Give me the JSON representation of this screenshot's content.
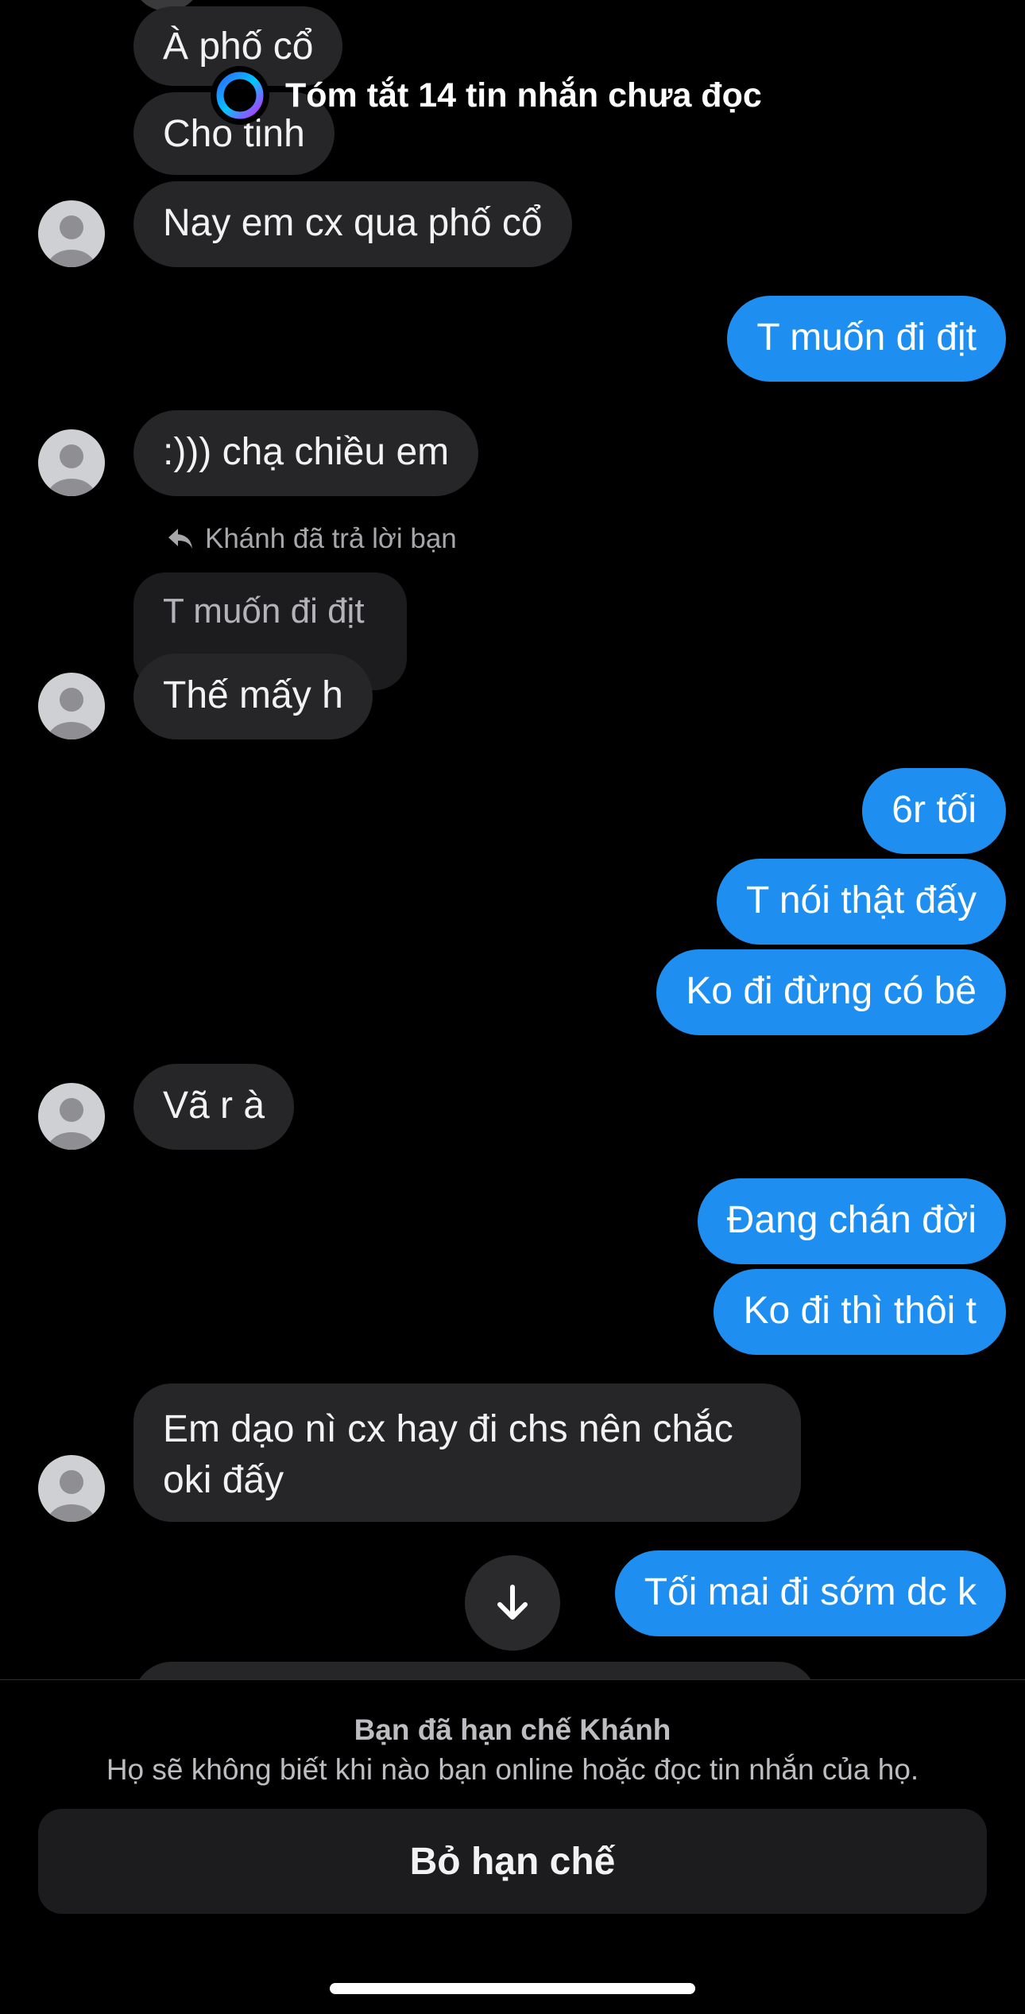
{
  "summary": {
    "text": "Tóm tắt 14 tin nhắn chưa đọc"
  },
  "messages": {
    "m0": "À phố cổ",
    "m1": "Cho tinh",
    "m2": "Nay em cx qua phố cổ",
    "m3": "T muốn đi địt",
    "m4": ":))) chạ chiều em",
    "reply_label": "Khánh đã trả lời bạn",
    "quoted": "T muốn đi địt",
    "m5": "Thế mấy h",
    "m6": "6r tối",
    "m7": "T nói thật đấy",
    "m8": "Ko đi đừng có bê",
    "m9": "Vã r à",
    "m10": "Đang chán đời",
    "m11": "Ko đi thì thôi t",
    "m12": "Em dạo nì cx hay đi chs nên chắc oki đấy",
    "m13": "Tối mai đi sớm dc k"
  },
  "footer": {
    "title": "Bạn đã hạn chế Khánh",
    "subtitle": "Họ sẽ không biết khi nào bạn online hoặc đọc tin nhắn của họ.",
    "button": "Bỏ hạn chế"
  },
  "colors": {
    "outgoing": "#1e8ff0",
    "incoming": "#262628"
  },
  "icons": [
    "summary-ring-icon",
    "reply-arrow-icon",
    "arrow-down-icon",
    "avatar-placeholder-icon"
  ]
}
